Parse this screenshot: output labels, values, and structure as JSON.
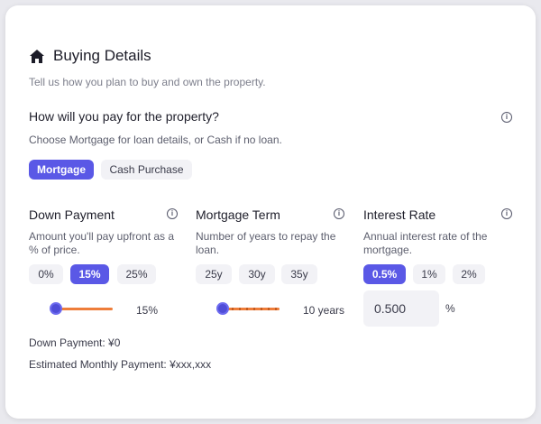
{
  "header": {
    "title": "Buying Details",
    "subtitle": "Tell us how you plan to buy and own the property."
  },
  "payment": {
    "question": "How will you pay for the property?",
    "hint": "Choose Mortgage for loan details, or Cash if no loan.",
    "options": [
      "Mortgage",
      "Cash Purchase"
    ],
    "selected": "Mortgage"
  },
  "down_payment": {
    "title": "Down Payment",
    "description": "Amount you'll pay upfront as a % of price.",
    "options": [
      "0%",
      "15%",
      "25%"
    ],
    "selected": "15%",
    "slider_value_label": "15%",
    "slider_fraction": 0.15
  },
  "mortgage_term": {
    "title": "Mortgage Term",
    "description": "Number of years to repay the loan.",
    "options": [
      "25y",
      "30y",
      "35y"
    ],
    "selected": null,
    "slider_value_label": "10 years",
    "slider_fraction": 0.0
  },
  "interest_rate": {
    "title": "Interest Rate",
    "description": "Annual interest rate of the mortgage.",
    "options": [
      "0.5%",
      "1%",
      "2%"
    ],
    "selected": "0.5%",
    "input_value": "0.500",
    "unit": "%"
  },
  "summary": {
    "down_payment_line": "Down Payment: ¥0",
    "monthly_line": "Estimated Monthly Payment: ¥xxx,xxx"
  },
  "colors": {
    "accent": "#5a58e6",
    "slider_track": "#ee7d3a",
    "pill_bg": "#f2f2f6"
  },
  "icons": {
    "title_icon": "home-icon",
    "info_icon": "info-icon"
  }
}
